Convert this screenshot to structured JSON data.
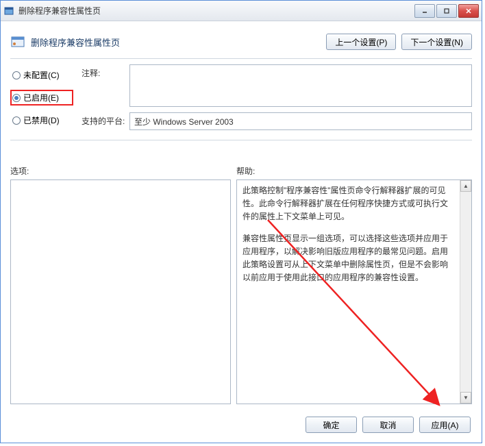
{
  "window": {
    "title": "删除程序兼容性属性页"
  },
  "header": {
    "title": "删除程序兼容性属性页",
    "prev_setting": "上一个设置(P)",
    "next_setting": "下一个设置(N)"
  },
  "radios": {
    "not_configured": "未配置(C)",
    "enabled": "已启用(E)",
    "disabled": "已禁用(D)"
  },
  "fields": {
    "comment_label": "注释:",
    "platform_label": "支持的平台:",
    "platform_value": "至少 Windows Server 2003"
  },
  "mid": {
    "options_label": "选项:",
    "help_label": "帮助:"
  },
  "help": {
    "p1": "此策略控制\"程序兼容性\"属性页命令行解释器扩展的可见性。此命令行解释器扩展在任何程序快捷方式或可执行文件的属性上下文菜单上可见。",
    "p2": "兼容性属性页显示一组选项，可以选择这些选项并应用于应用程序，以解决影响旧版应用程序的最常见问题。启用此策略设置可从上下文菜单中删除属性页，但是不会影响以前应用于使用此接口的应用程序的兼容性设置。"
  },
  "footer": {
    "ok": "确定",
    "cancel": "取消",
    "apply": "应用(A)"
  }
}
